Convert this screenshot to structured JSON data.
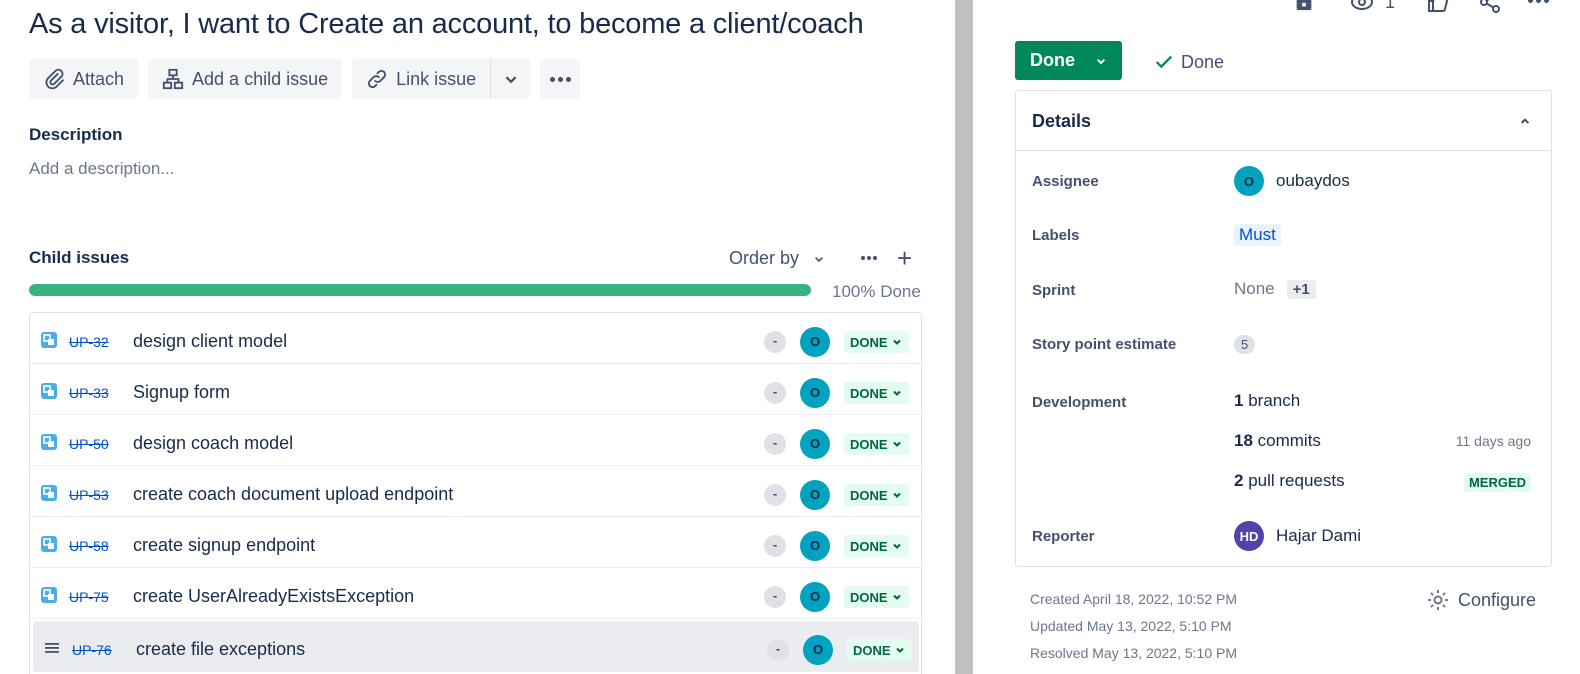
{
  "issue": {
    "title": "As a visitor, I want to Create an account, to become a client/coach"
  },
  "toolbar": {
    "attach_label": "Attach",
    "add_child_label": "Add a child issue",
    "link_issue_label": "Link issue"
  },
  "description": {
    "label": "Description",
    "placeholder": "Add a description..."
  },
  "child_issues": {
    "label": "Child issues",
    "order_by_label": "Order by",
    "progress": {
      "percent": 100,
      "label": "100% Done"
    },
    "items": [
      {
        "key": "UP-32",
        "summary": "design client model",
        "priority": "-",
        "assignee_initial": "O",
        "status": "DONE",
        "type": "subtask"
      },
      {
        "key": "UP-33",
        "summary": "Signup form",
        "priority": "-",
        "assignee_initial": "O",
        "status": "DONE",
        "type": "subtask"
      },
      {
        "key": "UP-50",
        "summary": "design coach model",
        "priority": "-",
        "assignee_initial": "O",
        "status": "DONE",
        "type": "subtask"
      },
      {
        "key": "UP-53",
        "summary": "create coach document upload endpoint",
        "priority": "-",
        "assignee_initial": "O",
        "status": "DONE",
        "type": "subtask"
      },
      {
        "key": "UP-58",
        "summary": "create signup endpoint",
        "priority": "-",
        "assignee_initial": "O",
        "status": "DONE",
        "type": "subtask"
      },
      {
        "key": "UP-75",
        "summary": "create UserAlreadyExistsException",
        "priority": "-",
        "assignee_initial": "O",
        "status": "DONE",
        "type": "subtask"
      },
      {
        "key": "UP-76",
        "summary": "create file exceptions",
        "priority": "-",
        "assignee_initial": "O",
        "status": "DONE",
        "type": "list"
      }
    ]
  },
  "header_actions": {
    "watchers_count": "1"
  },
  "status_button": {
    "label": "Done"
  },
  "resolution": {
    "label": "Done"
  },
  "details": {
    "title": "Details",
    "assignee": {
      "label": "Assignee",
      "initial": "O",
      "name": "oubaydos"
    },
    "labels": {
      "label": "Labels",
      "value": "Must"
    },
    "sprint": {
      "label": "Sprint",
      "value": "None",
      "extra": "+1"
    },
    "story_points": {
      "label": "Story point estimate",
      "value": "5"
    },
    "development": {
      "label": "Development",
      "branch_count": "1",
      "branch_text": "branch",
      "commit_count": "18",
      "commit_text": "commits",
      "commit_time": "11 days ago",
      "pr_count": "2",
      "pr_text": "pull requests",
      "pr_status": "MERGED"
    },
    "reporter": {
      "label": "Reporter",
      "initials": "HD",
      "name": "Hajar Dami"
    }
  },
  "meta": {
    "created": "Created April 18, 2022, 10:52 PM",
    "updated": "Updated May 13, 2022, 5:10 PM",
    "resolved": "Resolved May 13, 2022, 5:10 PM",
    "configure_label": "Configure"
  },
  "colors": {
    "status_green": "#00875a",
    "progress_green": "#36b37e",
    "assignee_avatar": "#00a3bf",
    "reporter_avatar": "#5243aa",
    "link_blue": "#0052cc"
  }
}
